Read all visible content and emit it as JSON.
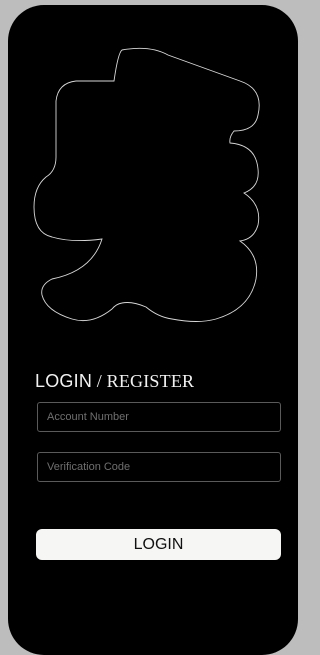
{
  "auth": {
    "title_login": "LOGIN",
    "title_separator": " / ",
    "title_register": "REGISTER",
    "account_placeholder": "Account Number",
    "code_placeholder": "Verification Code",
    "login_button": "LOGIN"
  },
  "colors": {
    "background": "#000000",
    "outer": "#bdbdbd",
    "button": "#f6f6f4",
    "text": "#f2f2f2"
  },
  "icons": {
    "logo": "brand-logo-icon"
  }
}
